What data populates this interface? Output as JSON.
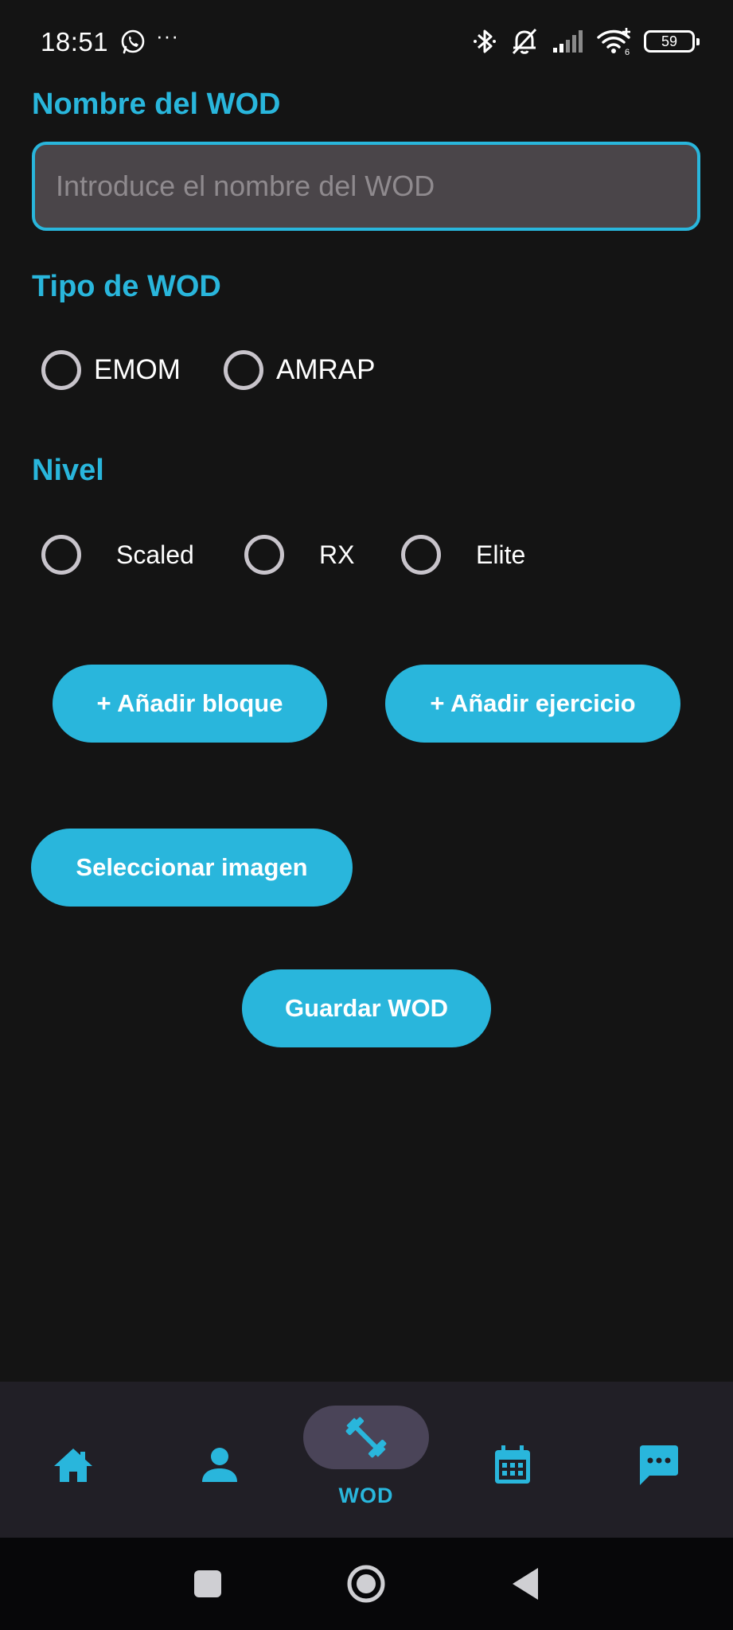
{
  "status_bar": {
    "time": "18:51",
    "more": "···",
    "battery": "59",
    "icons": [
      "whatsapp-icon",
      "bluetooth-icon",
      "muted-bell-icon",
      "signal-icon",
      "wifi-icon",
      "battery-icon"
    ]
  },
  "form": {
    "name_title": "Nombre del WOD",
    "name_placeholder": "Introduce el nombre del WOD",
    "name_value": "",
    "type_title": "Tipo de WOD",
    "type_options": [
      "EMOM",
      "AMRAP"
    ],
    "level_title": "Nivel",
    "level_options": [
      "Scaled",
      "RX",
      "Elite"
    ],
    "add_block": "+ Añadir bloque",
    "add_exercise": "+ Añadir ejercicio",
    "select_image": "Seleccionar imagen",
    "save": "Guardar WOD"
  },
  "bottom_nav": {
    "items": [
      {
        "icon": "home-icon",
        "label": ""
      },
      {
        "icon": "person-icon",
        "label": ""
      },
      {
        "icon": "dumbbell-icon",
        "label": "WOD",
        "selected": true
      },
      {
        "icon": "calendar-icon",
        "label": ""
      },
      {
        "icon": "chat-icon",
        "label": ""
      }
    ]
  },
  "system_nav": {
    "icons": [
      "recents-icon",
      "home-circle-icon",
      "back-icon"
    ]
  },
  "colors": {
    "background": "#141414",
    "accent": "#29b6dc",
    "input_bg": "#4a4549",
    "nav_bg": "#211f26",
    "nav_pill": "#4a4458"
  }
}
